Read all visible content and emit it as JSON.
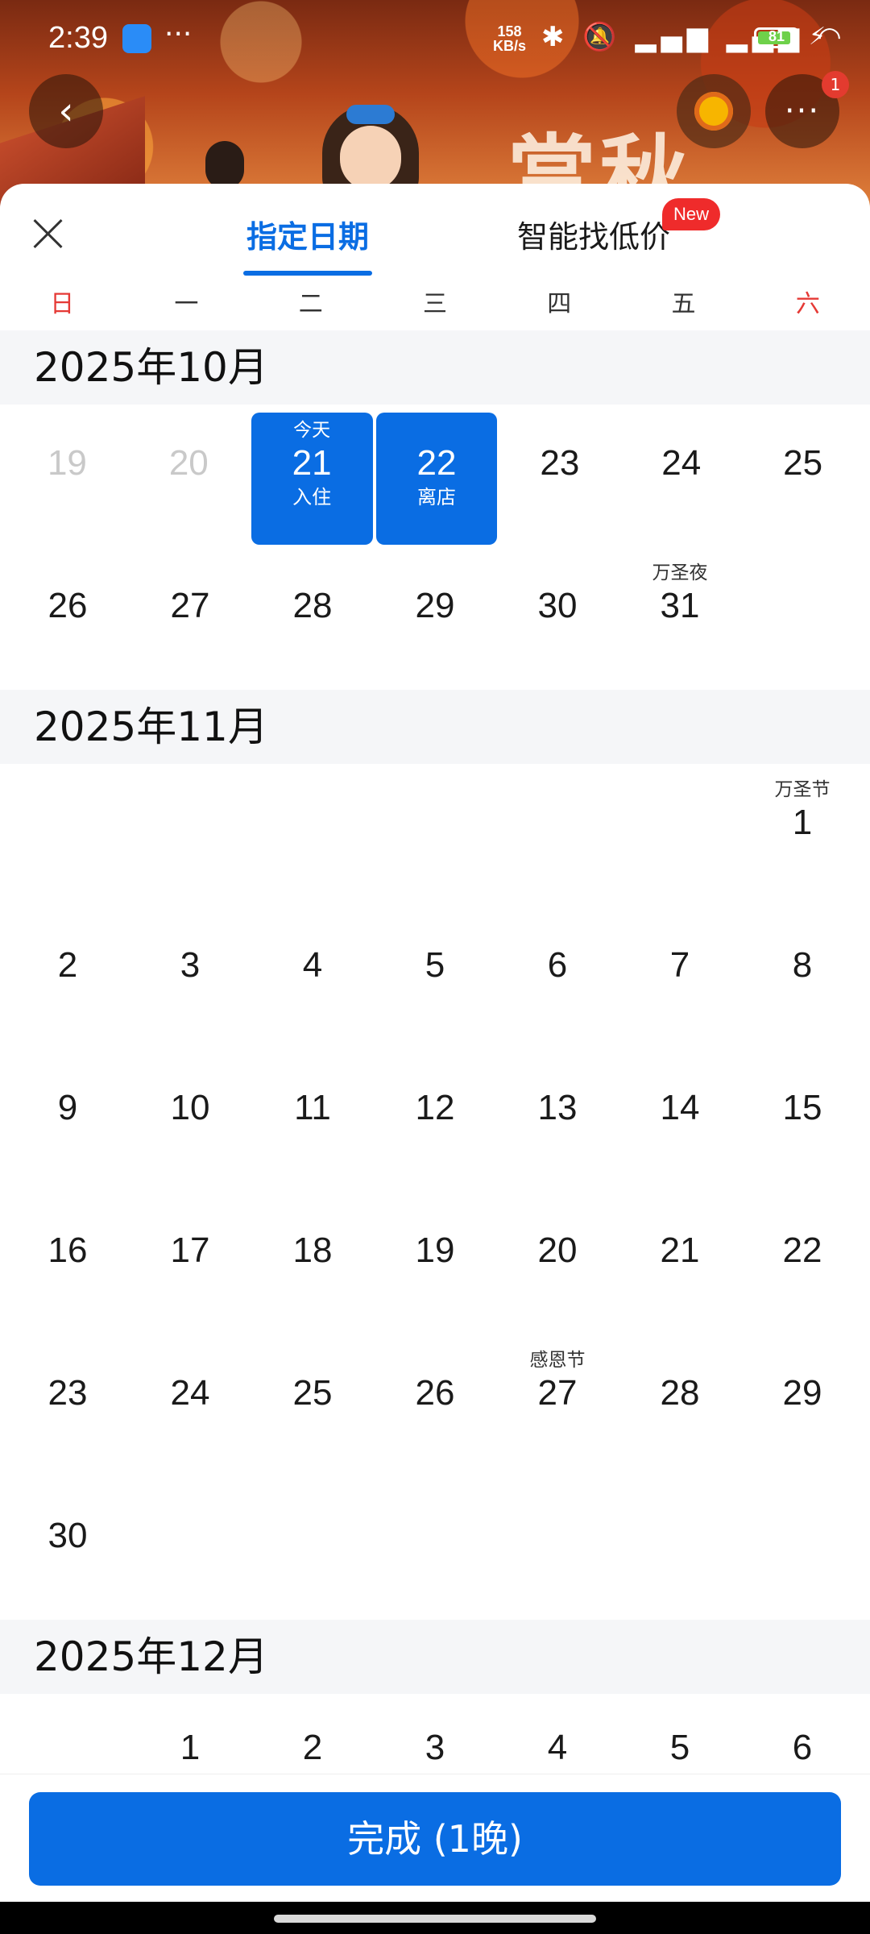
{
  "status_bar": {
    "time": "2:39",
    "dots": "···",
    "net_speed_top": "158",
    "net_speed_bottom": "KB/s",
    "icons": "✱ 🔕 ▂▄▆ ▂▄▆ ◠",
    "battery": "81"
  },
  "hero": {
    "banner_text": "赏秋",
    "notification_count": "1",
    "back_icon": "‹",
    "more_icon": "···"
  },
  "tabs": {
    "date_label": "指定日期",
    "low_price_label": "智能找低价",
    "new_badge": "New"
  },
  "weekdays": [
    "日",
    "一",
    "二",
    "三",
    "四",
    "五",
    "六"
  ],
  "months": {
    "oct": "2025年10月",
    "nov": "2025年11月",
    "dec": "2025年12月"
  },
  "oct": {
    "week1": [
      {
        "n": "19"
      },
      {
        "n": "20"
      },
      {
        "n": "21",
        "top": "今天",
        "bot": "入住"
      },
      {
        "n": "22",
        "bot": "离店"
      },
      {
        "n": "23"
      },
      {
        "n": "24"
      },
      {
        "n": "25"
      }
    ],
    "week2": [
      {
        "n": "26"
      },
      {
        "n": "27"
      },
      {
        "n": "28"
      },
      {
        "n": "29"
      },
      {
        "n": "30"
      },
      {
        "n": "31",
        "top": "万圣夜"
      }
    ]
  },
  "nov": {
    "w1": [
      {
        "n": "1",
        "top": "万圣节"
      }
    ],
    "w2": [
      "2",
      "3",
      "4",
      "5",
      "6",
      "7",
      "8"
    ],
    "w3": [
      "9",
      "10",
      "11",
      "12",
      "13",
      "14",
      "15"
    ],
    "w4": [
      "16",
      "17",
      "18",
      "19",
      "20",
      "21",
      "22"
    ],
    "w5": [
      {
        "n": "23"
      },
      {
        "n": "24"
      },
      {
        "n": "25"
      },
      {
        "n": "26"
      },
      {
        "n": "27",
        "top": "感恩节"
      },
      {
        "n": "28"
      },
      {
        "n": "29"
      }
    ],
    "w6": [
      "30"
    ]
  },
  "dec": {
    "w1": [
      "1",
      "2",
      "3",
      "4",
      "5",
      "6"
    ]
  },
  "footer": {
    "done_label": "完成 (1晚)"
  },
  "colors": {
    "accent": "#0a6de3",
    "weekend_red": "#e53935",
    "badge_red": "#ef2b2b"
  },
  "icons": {
    "close": "close-icon",
    "back": "back-arrow-icon",
    "more": "more-dots-icon"
  }
}
